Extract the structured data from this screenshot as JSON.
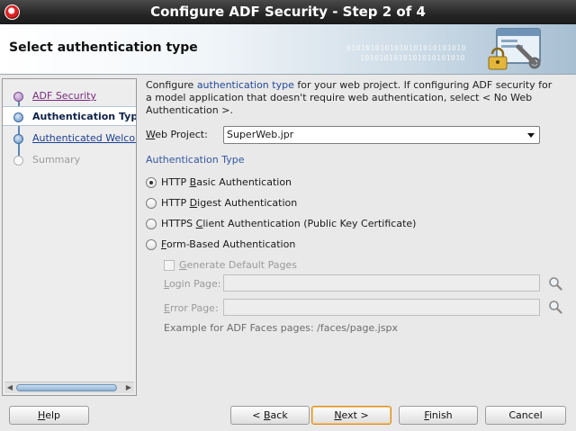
{
  "window": {
    "title": "Configure ADF Security - Step 2 of 4",
    "app_icon": "oracle-jdeveloper-icon"
  },
  "header": {
    "title": "Select authentication type",
    "binary_line1": "0101010101010101010101010",
    "binary_line2": "1010101010101010101010",
    "icon": "security-padlock-window-icon"
  },
  "train": {
    "items": [
      {
        "label": "ADF Security",
        "state": "visited"
      },
      {
        "label": "Authentication Type",
        "state": "current"
      },
      {
        "label": "Authenticated Welcome",
        "state": "link"
      },
      {
        "label": "Summary",
        "state": "disabled"
      }
    ]
  },
  "intro": {
    "part1": "Configure ",
    "highlight": "authentication type",
    "part2": " for your web project. If configuring ADF security for a model application that doesn't require web authentication, select < No Web Authentication >."
  },
  "project": {
    "label_mnemonic": "W",
    "label_rest": "eb Project:",
    "selected": "SuperWeb.jpr"
  },
  "auth": {
    "section_title": "Authentication Type",
    "options": [
      {
        "pre": "HTTP ",
        "mn": "B",
        "post": "asic Authentication",
        "selected": true
      },
      {
        "pre": "HTTP ",
        "mn": "D",
        "post": "igest Authentication",
        "selected": false
      },
      {
        "pre": "HTTPS ",
        "mn": "C",
        "post": "lient Authentication (Public Key Certificate)",
        "selected": false
      },
      {
        "pre": "",
        "mn": "F",
        "post": "orm-Based Authentication",
        "selected": false
      }
    ]
  },
  "form_based": {
    "generate_pre": "",
    "generate_mn": "G",
    "generate_post": "enerate Default Pages",
    "login_mn": "L",
    "login_post": "ogin Page:",
    "login_value": "",
    "error_mn": "E",
    "error_post": "rror Page:",
    "error_value": "",
    "example": "Example for ADF Faces pages: /faces/page.jspx"
  },
  "buttons": {
    "help_mn": "H",
    "help_post": "elp",
    "back_pre": "< ",
    "back_mn": "B",
    "back_post": "ack",
    "next_mn": "N",
    "next_post": "ext >",
    "finish_mn": "F",
    "finish_post": "inish",
    "cancel": "Cancel"
  },
  "colors": {
    "accent_link": "#1d3f8f",
    "visited": "#7a2b80",
    "section": "#3557a0",
    "default_button_border": "#d98d26"
  }
}
